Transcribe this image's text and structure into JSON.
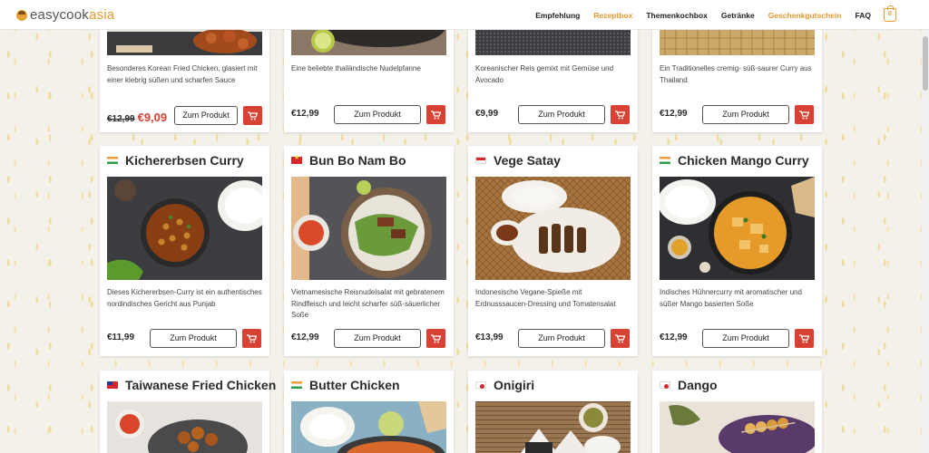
{
  "header": {
    "logo": {
      "part1": "easycook",
      "part2": "asia"
    },
    "nav": [
      "Empfehlung",
      "Rezeptbox",
      "Themenkochbox",
      "Getränke",
      "Geschenkgutschein",
      "FAQ"
    ],
    "cart_count": "0"
  },
  "buttons": {
    "product_label": "Zum Produkt"
  },
  "row1": [
    {
      "desc": "Besonderes Korean Fried Chicken, glasiert mit einer klebrig süßen und scharfen Sauce",
      "old_price": "€12,99",
      "sale_price": "€9,09"
    },
    {
      "desc": "Eine beliebte thailändische Nudelpfanne",
      "price": "€12,99"
    },
    {
      "desc": "Koreanischer Reis gemixt mit Gemüse und Avocado",
      "price": "€9,99"
    },
    {
      "desc": "Ein Traditionelles cremig- süß-saurer Curry aus Thailand",
      "price": "€12,99"
    }
  ],
  "row2": [
    {
      "title": "Kichererbsen Curry",
      "flag": "india-flag-icon",
      "desc": "Dieses Kichererbsen-Curry ist ein authentisches nordindisches Gericht aus Punjab",
      "price": "€11,99"
    },
    {
      "title": "Bun Bo Nam Bo",
      "flag": "vietnam-flag-icon",
      "desc": "Vietnamesische Reisnudelsalat mit gebratenem Rindfleisch und leicht scharfer süß-säuerlicher Soße",
      "price": "€12,99"
    },
    {
      "title": "Vege Satay",
      "flag": "indonesia-flag-icon",
      "desc": "Indonesische Vegane-Spieße mit Erdnusssaucen-Dressing und Tomatensalat",
      "price": "€13,99"
    },
    {
      "title": "Chicken Mango Curry",
      "flag": "india-flag-icon",
      "desc": "Indisches Hühnercurry mit aromatischer und süßer Mango basierten Soße",
      "price": "€12,99"
    }
  ],
  "row3": [
    {
      "title": "Taiwanese Fried Chicken",
      "flag": "taiwan-flag-icon"
    },
    {
      "title": "Butter Chicken",
      "flag": "india-flag-icon"
    },
    {
      "title": "Onigiri",
      "flag": "japan-flag-icon"
    },
    {
      "title": "Dango",
      "flag": "japan-flag-icon"
    }
  ]
}
